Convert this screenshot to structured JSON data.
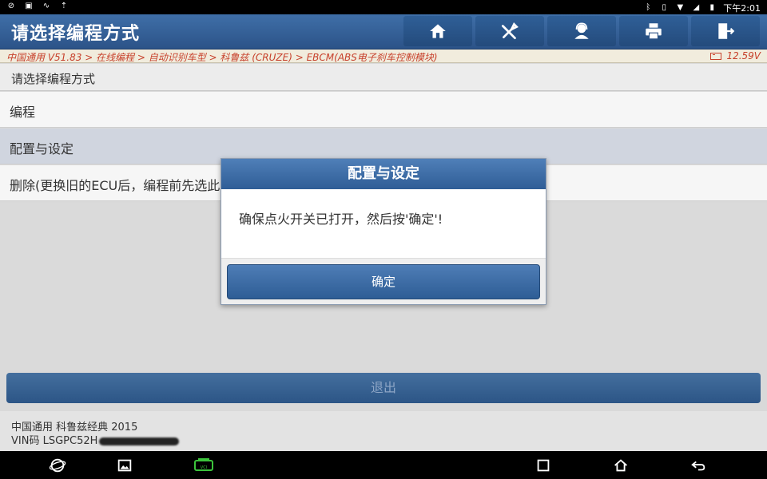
{
  "statusbar": {
    "time": "下午2:01"
  },
  "header": {
    "title": "请选择编程方式",
    "buttons": [
      {
        "name": "home-icon"
      },
      {
        "name": "diagnose-tools-icon"
      },
      {
        "name": "support-agent-icon"
      },
      {
        "name": "printer-icon"
      },
      {
        "name": "exit-door-icon"
      }
    ]
  },
  "breadcrumb": {
    "path": "中国通用 V51.83 > 在线编程 > 自动识别车型 > 科鲁兹 (CRUZE) > EBCM(ABS电子刹车控制模块)",
    "voltage": "12.59V"
  },
  "subheader": "请选择编程方式",
  "options": [
    {
      "label": "编程"
    },
    {
      "label": "配置与设定"
    },
    {
      "label": "删除(更换旧的ECU后，编程前先选此"
    }
  ],
  "exit_label": "退出",
  "footer": {
    "vehicle": "中国通用 科鲁兹经典 2015",
    "vin_prefix": "VIN码 LSGPC52H"
  },
  "dialog": {
    "title": "配置与设定",
    "message": "确保点火开关已打开，然后按'确定'!",
    "ok_label": "确定"
  },
  "colors": {
    "header_blue": "#2c5388",
    "breadcrumb_red": "#c7402b",
    "selected_row": "#d0d5df"
  }
}
